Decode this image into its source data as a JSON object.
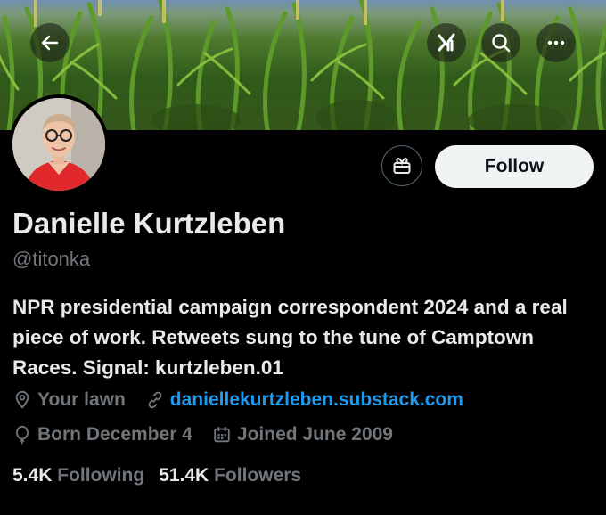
{
  "profile": {
    "name": "Danielle Kurtzleben",
    "handle": "@titonka",
    "bio": "NPR presidential campaign correspondent 2024 and a real piece of work. Retweets sung to the tune of Camptown Races. Signal: kurtzleben.01",
    "location": "Your lawn",
    "website": "daniellekurtzleben.substack.com",
    "born": "Born December 4",
    "joined": "Joined June 2009",
    "following_count": "5.4K",
    "following_label": "Following",
    "followers_count": "51.4K",
    "followers_label": "Followers"
  },
  "actions": {
    "follow_label": "Follow"
  },
  "icons": {
    "back": "arrow-left-icon",
    "grok": "grok-icon",
    "search": "search-icon",
    "more": "more-icon",
    "gift": "gift-icon",
    "location": "location-pin-icon",
    "link": "link-icon",
    "born": "balloon-icon",
    "joined": "calendar-icon"
  },
  "colors": {
    "background": "#000000",
    "text_primary": "#e7e9ea",
    "text_secondary": "#71767b",
    "link": "#1d9bf0",
    "follow_bg": "#eff3f4"
  }
}
